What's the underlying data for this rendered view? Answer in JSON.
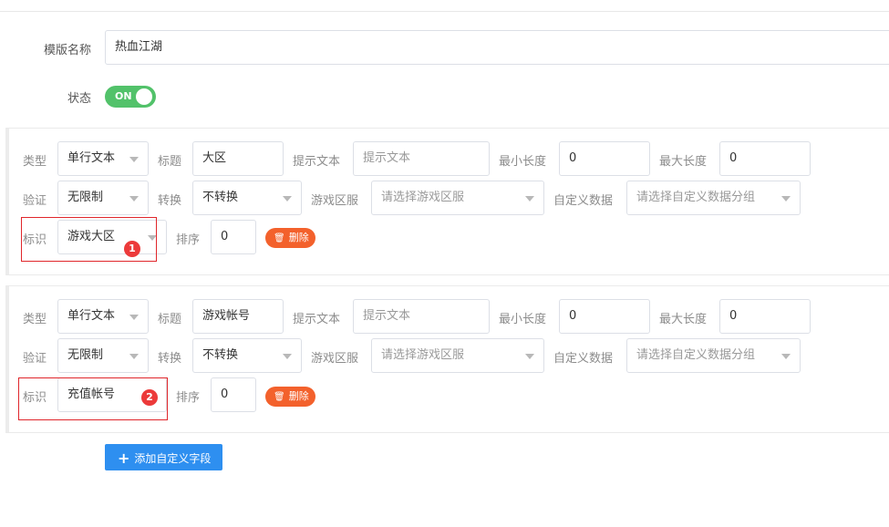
{
  "form": {
    "template_name_label": "模版名称",
    "template_name_value": "热血江湖",
    "status_label": "状态",
    "status_toggle": "ON"
  },
  "fields": [
    {
      "type_label": "类型",
      "type_value": "单行文本",
      "title_label": "标题",
      "title_value": "大区",
      "hint_label": "提示文本",
      "hint_value": "提示文本",
      "min_label": "最小长度",
      "min_value": "0",
      "max_label": "最大长度",
      "max_value": "0",
      "validate_label": "验证",
      "validate_value": "无限制",
      "convert_label": "转换",
      "convert_value": "不转换",
      "server_label": "游戏区服",
      "server_placeholder": "请选择游戏区服",
      "custom_label": "自定义数据",
      "custom_placeholder": "请选择自定义数据分组",
      "id_label": "标识",
      "id_value": "游戏大区",
      "sort_label": "排序",
      "sort_value": "0",
      "delete_label": "删除",
      "badge": "1"
    },
    {
      "type_label": "类型",
      "type_value": "单行文本",
      "title_label": "标题",
      "title_value": "游戏帐号",
      "hint_label": "提示文本",
      "hint_value": "提示文本",
      "min_label": "最小长度",
      "min_value": "0",
      "max_label": "最大长度",
      "max_value": "0",
      "validate_label": "验证",
      "validate_value": "无限制",
      "convert_label": "转换",
      "convert_value": "不转换",
      "server_label": "游戏区服",
      "server_placeholder": "请选择游戏区服",
      "custom_label": "自定义数据",
      "custom_placeholder": "请选择自定义数据分组",
      "id_label": "标识",
      "id_value": "充值帐号",
      "sort_label": "排序",
      "sort_value": "0",
      "delete_label": "删除",
      "badge": "2"
    }
  ],
  "add_button_label": "添加自定义字段",
  "colors": {
    "toggle_on": "#52c26a",
    "delete_button": "#f3612c",
    "add_button": "#2e8ff0",
    "annotation_red": "#e0262b"
  }
}
